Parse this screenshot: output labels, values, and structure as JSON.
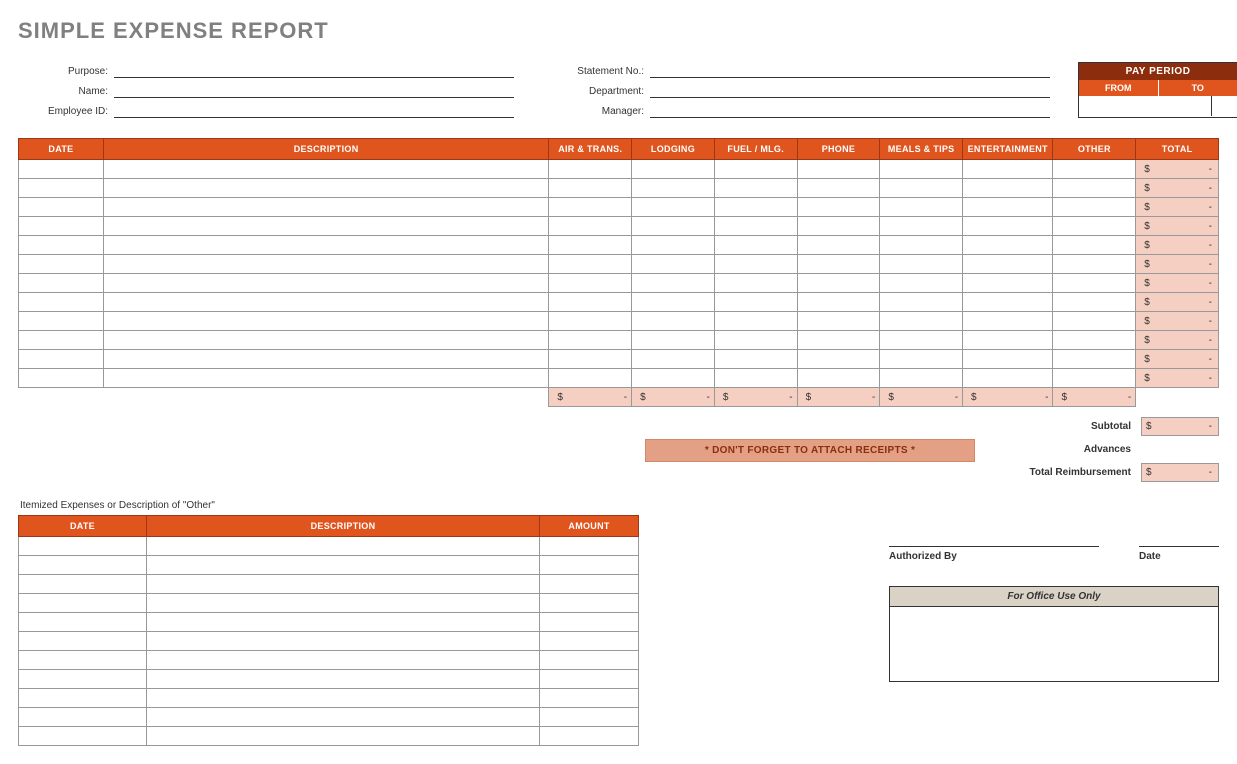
{
  "title": "SIMPLE EXPENSE REPORT",
  "meta": {
    "left": [
      {
        "label": "Purpose:",
        "value": ""
      },
      {
        "label": "Name:",
        "value": ""
      },
      {
        "label": "Employee ID:",
        "value": ""
      }
    ],
    "right": [
      {
        "label": "Statement No.:",
        "value": ""
      },
      {
        "label": "Department:",
        "value": ""
      },
      {
        "label": "Manager:",
        "value": ""
      }
    ]
  },
  "pay": {
    "header": "PAY PERIOD",
    "from": "FROM",
    "to": "TO",
    "from_val": "",
    "to_val": ""
  },
  "main": {
    "headers": [
      "DATE",
      "DESCRIPTION",
      "AIR & TRANS.",
      "LODGING",
      "FUEL / MLG.",
      "PHONE",
      "MEALS & TIPS",
      "ENTERTAINMENT",
      "OTHER",
      "TOTAL"
    ],
    "rows": 12,
    "col_sums": [
      "-",
      "-",
      "-",
      "-",
      "-",
      "-",
      "-"
    ],
    "row_totals": [
      "-",
      "-",
      "-",
      "-",
      "-",
      "-",
      "-",
      "-",
      "-",
      "-",
      "-",
      "-"
    ]
  },
  "banner": "* DON'T FORGET TO ATTACH RECEIPTS *",
  "totals": {
    "subtotal": {
      "label": "Subtotal",
      "value": "-"
    },
    "advances": {
      "label": "Advances",
      "value": ""
    },
    "reimb": {
      "label": "Total Reimbursement",
      "value": "-"
    }
  },
  "item": {
    "title": "Itemized Expenses or Description of \"Other\"",
    "headers": [
      "DATE",
      "DESCRIPTION",
      "AMOUNT"
    ],
    "rows": 11
  },
  "sig": {
    "auth": "Authorized By",
    "date": "Date"
  },
  "office": "For Office Use Only",
  "currency": "$"
}
